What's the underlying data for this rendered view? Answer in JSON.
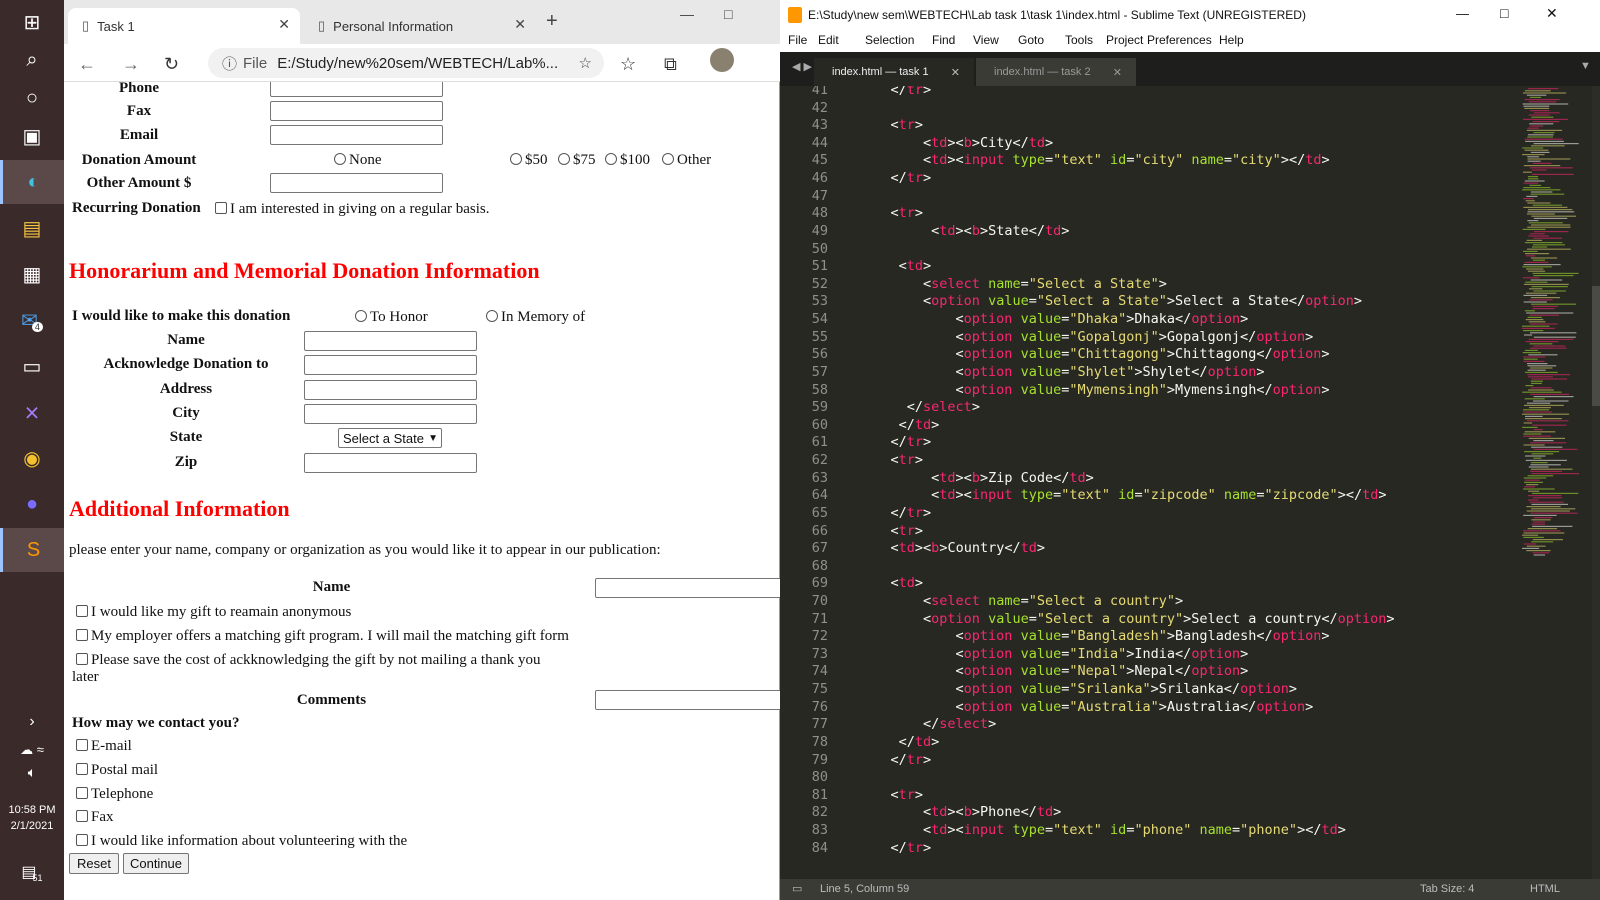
{
  "taskbar": {
    "time": "10:58 PM",
    "date": "2/1/2021",
    "mail_badge": "4",
    "notif_badge": "51"
  },
  "browser": {
    "tabs": [
      {
        "label": "Task 1"
      },
      {
        "label": "Personal Information"
      }
    ],
    "address_prefix": "File",
    "address": "E:/Study/new%20sem/WEBTECH/Lab%..."
  },
  "form": {
    "phone_label": "Phone",
    "fax_label": "Fax",
    "email_label": "Email",
    "donation_amount_label": "Donation Amount",
    "donation_options": [
      "None",
      "$50",
      "$75",
      "$100",
      "Other"
    ],
    "other_amount_label": "Other Amount $",
    "recurring_label": "Recurring Donation",
    "recurring_text": "I am interested in giving on a regular basis.",
    "honorarium_heading": "Honorarium and Memorial Donation Information",
    "donation_for_label": "I would like to make this donation",
    "donation_for_options": [
      "To Honor",
      "In Memory of"
    ],
    "hon_name_label": "Name",
    "acknowledge_label": "Acknowledge Donation to",
    "address_label": "Address",
    "city_label": "City",
    "state_label": "State",
    "state_select_value": "Select a State",
    "zip_label": "Zip",
    "additional_heading": "Additional Information",
    "additional_text": "please enter your name, company or organization as you would like it to appear in our publication:",
    "add_name_label": "Name",
    "checks": [
      "I would like my gift to reamain anonymous",
      "My employer offers a matching gift program. I will mail the matching gift form",
      "Please save the cost of ackknowledging the gift by not mailing a thank you"
    ],
    "checks_continuation": "later",
    "comments_label": "Comments",
    "contact_label": "How may we contact you?",
    "contact_options": [
      "E-mail",
      "Postal mail",
      "Telephone",
      "Fax",
      "I would like information about volunteering with the"
    ],
    "reset_button": "Reset",
    "continue_button": "Continue"
  },
  "editor": {
    "title": "E:\\Study\\new sem\\WEBTECH\\Lab task 1\\task 1\\index.html - Sublime Text (UNREGISTERED)",
    "menu": [
      "File",
      "Edit",
      "Selection",
      "Find",
      "View",
      "Goto",
      "Tools",
      "Project",
      "Preferences",
      "Help"
    ],
    "tabs": [
      "index.html — task 1",
      "index.html — task 2"
    ],
    "status_position": "Line 5, Column 59",
    "status_tabsize": "Tab Size: 4",
    "status_syntax": "HTML",
    "lines": [
      {
        "n": "41",
        "indent": "    ",
        "code": "</tr>"
      },
      {
        "n": "42",
        "indent": "",
        "code": ""
      },
      {
        "n": "43",
        "indent": "    ",
        "code": "<tr>"
      },
      {
        "n": "44",
        "indent": "        ",
        "code": "<td><b>City</td>"
      },
      {
        "n": "45",
        "indent": "        ",
        "code": "<td><input type=\"text\" id=\"city\" name=\"city\"></td>"
      },
      {
        "n": "46",
        "indent": "    ",
        "code": "</tr>"
      },
      {
        "n": "47",
        "indent": "",
        "code": ""
      },
      {
        "n": "48",
        "indent": "    ",
        "code": "<tr>"
      },
      {
        "n": "49",
        "indent": "         ",
        "code": "<td><b>State</td>"
      },
      {
        "n": "50",
        "indent": "",
        "code": ""
      },
      {
        "n": "51",
        "indent": "     ",
        "code": "<td>"
      },
      {
        "n": "52",
        "indent": "        ",
        "code": "<select name=\"Select a State\">"
      },
      {
        "n": "53",
        "indent": "        ",
        "code": "<option value=\"Select a State\">Select a State</option>"
      },
      {
        "n": "54",
        "indent": "            ",
        "code": "<option value=\"Dhaka\">Dhaka</option>"
      },
      {
        "n": "55",
        "indent": "            ",
        "code": "<option value=\"Gopalgonj\">Gopalgonj</option>"
      },
      {
        "n": "56",
        "indent": "            ",
        "code": "<option value=\"Chittagong\">Chittagong</option>"
      },
      {
        "n": "57",
        "indent": "            ",
        "code": "<option value=\"Shylet\">Shylet</option>"
      },
      {
        "n": "58",
        "indent": "            ",
        "code": "<option value=\"Mymensingh\">Mymensingh</option>"
      },
      {
        "n": "59",
        "indent": "      ",
        "code": "</select>"
      },
      {
        "n": "60",
        "indent": "     ",
        "code": "</td>"
      },
      {
        "n": "61",
        "indent": "    ",
        "code": "</tr>"
      },
      {
        "n": "62",
        "indent": "    ",
        "code": "<tr>"
      },
      {
        "n": "63",
        "indent": "         ",
        "code": "<td><b>Zip Code</td>"
      },
      {
        "n": "64",
        "indent": "         ",
        "code": "<td><input type=\"text\" id=\"zipcode\" name=\"zipcode\"></td>"
      },
      {
        "n": "65",
        "indent": "    ",
        "code": "</tr>"
      },
      {
        "n": "66",
        "indent": "    ",
        "code": "<tr>"
      },
      {
        "n": "67",
        "indent": "    ",
        "code": "<td><b>Country</td>"
      },
      {
        "n": "68",
        "indent": "",
        "code": ""
      },
      {
        "n": "69",
        "indent": "    ",
        "code": "<td>"
      },
      {
        "n": "70",
        "indent": "        ",
        "code": "<select name=\"Select a country\">"
      },
      {
        "n": "71",
        "indent": "        ",
        "code": "<option value=\"Select a country\">Select a country</option>"
      },
      {
        "n": "72",
        "indent": "            ",
        "code": "<option value=\"Bangladesh\">Bangladesh</option>"
      },
      {
        "n": "73",
        "indent": "            ",
        "code": "<option value=\"India\">India</option>"
      },
      {
        "n": "74",
        "indent": "            ",
        "code": "<option value=\"Nepal\">Nepal</option>"
      },
      {
        "n": "75",
        "indent": "            ",
        "code": "<option value=\"Srilanka\">Srilanka</option>"
      },
      {
        "n": "76",
        "indent": "            ",
        "code": "<option value=\"Australia\">Australia</option>"
      },
      {
        "n": "77",
        "indent": "        ",
        "code": "</select>"
      },
      {
        "n": "78",
        "indent": "     ",
        "code": "</td>"
      },
      {
        "n": "79",
        "indent": "    ",
        "code": "</tr>"
      },
      {
        "n": "80",
        "indent": "",
        "code": ""
      },
      {
        "n": "81",
        "indent": "    ",
        "code": "<tr>"
      },
      {
        "n": "82",
        "indent": "        ",
        "code": "<td><b>Phone</td>"
      },
      {
        "n": "83",
        "indent": "        ",
        "code": "<td><input type=\"text\" id=\"phone\" name=\"phone\"></td>"
      },
      {
        "n": "84",
        "indent": "    ",
        "code": "</tr>"
      }
    ]
  },
  "colors": {
    "editor_bg": "#272822",
    "tag": "#f92672",
    "attr": "#a6e22e",
    "string": "#e6db74",
    "heading_red": "#ff0000"
  }
}
